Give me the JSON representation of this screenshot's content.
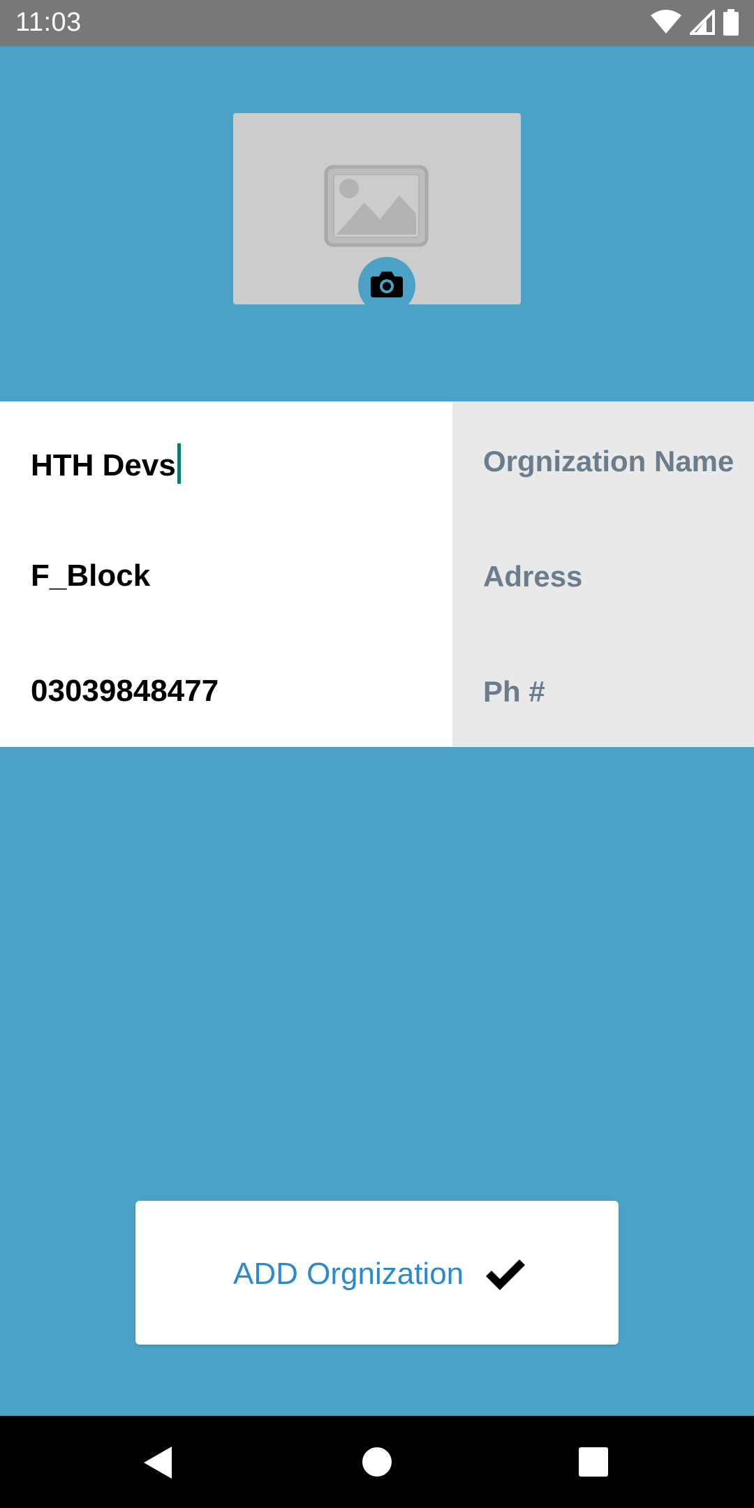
{
  "status_bar": {
    "time": "11:03",
    "icons": [
      "wifi-icon",
      "cellular-signal-icon",
      "battery-icon"
    ]
  },
  "header": {
    "image_placeholder_icon": "image-placeholder-icon",
    "camera_icon": "camera-icon"
  },
  "form": {
    "fields": [
      {
        "label": "Orgnization Name",
        "value": "HTH Devs"
      },
      {
        "label": "Adress",
        "value": "F_Block"
      },
      {
        "label": "Ph #",
        "value": "03039848477"
      }
    ]
  },
  "add_button": {
    "label": "ADD Orgnization",
    "icon": "check-icon"
  },
  "colors": {
    "background": "#4aa3c6",
    "label_panel": "#e9e9e9",
    "label_text": "#6b7c8c",
    "button_text": "#2a8ad1",
    "cursor": "#0b7d6e"
  },
  "nav_bar": {
    "icons": [
      "back-icon",
      "home-icon",
      "recents-icon"
    ]
  }
}
